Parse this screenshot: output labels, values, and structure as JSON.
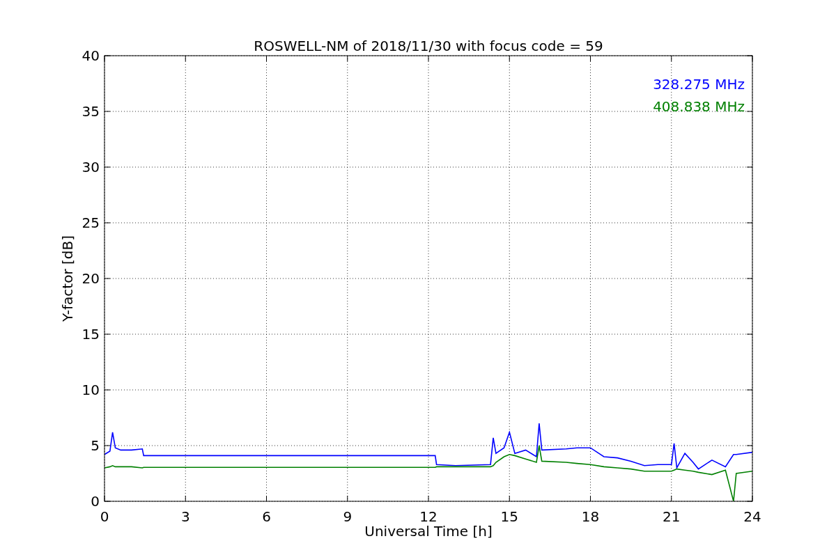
{
  "chart_data": {
    "type": "line",
    "title": "ROSWELL-NM of 2018/11/30 with focus code = 59",
    "xlabel": "Universal Time [h]",
    "ylabel": "Y-factor [dB]",
    "x": [
      0,
      0.2,
      0.3,
      0.4,
      0.6,
      1.0,
      1.4,
      1.45,
      12.25,
      12.3,
      13,
      14.3,
      14.4,
      14.5,
      14.8,
      15.0,
      15.2,
      15.6,
      16.0,
      16.1,
      16.2,
      17.1,
      17.5,
      18.0,
      18.5,
      19.0,
      19.5,
      20.0,
      20.5,
      21.0,
      21.1,
      21.2,
      21.5,
      21.8,
      22.0,
      22.5,
      23.0,
      23.3,
      23.4,
      24.0
    ],
    "series": [
      {
        "name": "328.275 MHz",
        "color": "#0000ff",
        "values": [
          4.2,
          4.5,
          6.2,
          4.8,
          4.6,
          4.6,
          4.7,
          4.1,
          4.1,
          3.3,
          3.2,
          3.3,
          5.7,
          4.3,
          4.8,
          6.2,
          4.3,
          4.6,
          4.0,
          7.0,
          4.6,
          4.7,
          4.8,
          4.8,
          4.0,
          3.9,
          3.6,
          3.2,
          3.3,
          3.3,
          5.2,
          3.0,
          4.3,
          3.5,
          2.9,
          3.7,
          3.1,
          4.2,
          4.2,
          4.4
        ]
      },
      {
        "name": "408.838 MHz",
        "color": "#008000",
        "values": [
          3.0,
          3.1,
          3.2,
          3.1,
          3.1,
          3.1,
          3.0,
          3.05,
          3.05,
          3.1,
          3.1,
          3.1,
          3.2,
          3.5,
          4.0,
          4.2,
          4.1,
          3.8,
          3.5,
          5.0,
          3.6,
          3.5,
          3.4,
          3.3,
          3.1,
          3.0,
          2.9,
          2.7,
          2.7,
          2.7,
          2.8,
          2.9,
          2.8,
          2.7,
          2.6,
          2.4,
          2.8,
          0.0,
          2.5,
          2.7
        ]
      }
    ],
    "xlim": [
      0,
      24
    ],
    "ylim": [
      0,
      40
    ],
    "xticks": [
      0,
      3,
      6,
      9,
      12,
      15,
      18,
      21,
      24
    ],
    "yticks": [
      0,
      5,
      10,
      15,
      20,
      25,
      30,
      35,
      40
    ],
    "grid": true
  }
}
